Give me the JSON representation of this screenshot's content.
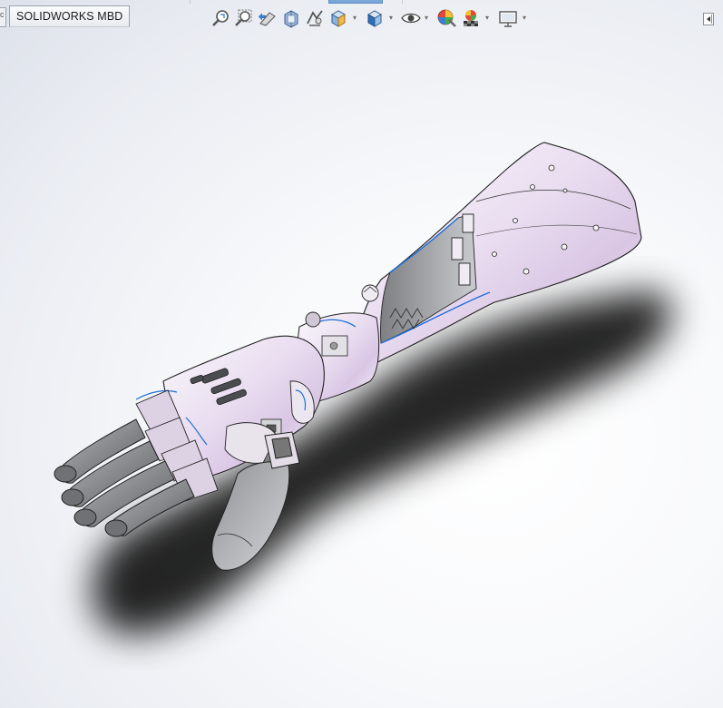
{
  "tabs": {
    "active": "SOLIDWORKS MBD",
    "stub": "c"
  },
  "toolbar": {
    "buttons": [
      {
        "name": "zoom-to-fit-icon"
      },
      {
        "name": "zoom-to-area-icon"
      },
      {
        "name": "previous-view-icon"
      },
      {
        "name": "section-view-icon"
      },
      {
        "name": "dynamic-annotation-views-icon"
      },
      {
        "name": "view-orientation-icon"
      },
      {
        "name": "display-style-icon"
      },
      {
        "name": "hide-show-items-icon"
      },
      {
        "name": "edit-appearance-icon"
      },
      {
        "name": "apply-scene-icon"
      },
      {
        "name": "view-settings-icon"
      }
    ]
  },
  "viewport": {
    "model": "prosthetic-arm-3d-model",
    "colors": {
      "background_center": "#ffffff",
      "background_edge": "#dde1e9",
      "shell": "#f3eef7",
      "shell_tint": "#d7c4e3",
      "finger": "#8a8c90",
      "edge": "#222222",
      "selection": "#1e6fd9"
    }
  }
}
